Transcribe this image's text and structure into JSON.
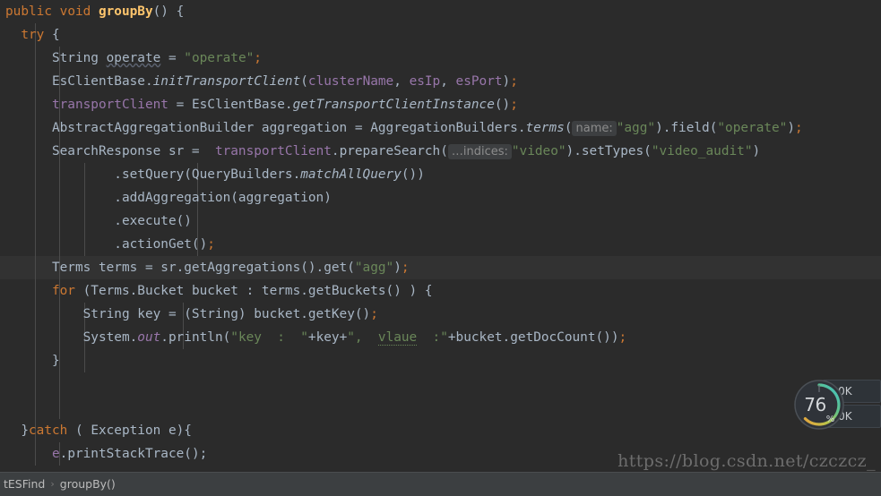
{
  "editor": {
    "lines": [
      {
        "indent_guides": [],
        "tokens": [
          {
            "t": "public",
            "c": "kw"
          },
          {
            "t": " ",
            "c": "plain"
          },
          {
            "t": "void",
            "c": "kw"
          },
          {
            "t": " ",
            "c": "plain"
          },
          {
            "t": "groupBy",
            "c": "fn"
          },
          {
            "t": "() {",
            "c": "punc"
          }
        ]
      },
      {
        "indent_guides": [
          39
        ],
        "tokens": [
          {
            "t": "  ",
            "c": "plain"
          },
          {
            "t": "try",
            "c": "kw"
          },
          {
            "t": " {",
            "c": "punc"
          }
        ]
      },
      {
        "indent_guides": [
          39,
          66
        ],
        "tokens": [
          {
            "t": "      ",
            "c": "plain"
          },
          {
            "t": "String",
            "c": "plain"
          },
          {
            "t": " ",
            "c": "plain"
          },
          {
            "t": "operate",
            "c": "warnvar"
          },
          {
            "t": " = ",
            "c": "punc"
          },
          {
            "t": "\"operate\"",
            "c": "str"
          },
          {
            "t": ";",
            "c": "semi"
          }
        ]
      },
      {
        "indent_guides": [
          39,
          66
        ],
        "tokens": [
          {
            "t": "      ",
            "c": "plain"
          },
          {
            "t": "EsClientBase.",
            "c": "plain"
          },
          {
            "t": "initTransportClient",
            "c": "stat-m"
          },
          {
            "t": "(",
            "c": "punc"
          },
          {
            "t": "clusterName",
            "c": "fld"
          },
          {
            "t": ", ",
            "c": "punc"
          },
          {
            "t": "esIp",
            "c": "fld"
          },
          {
            "t": ", ",
            "c": "punc"
          },
          {
            "t": "esPort",
            "c": "fld"
          },
          {
            "t": ")",
            "c": "punc"
          },
          {
            "t": ";",
            "c": "semi"
          }
        ]
      },
      {
        "indent_guides": [
          39,
          66
        ],
        "tokens": [
          {
            "t": "      ",
            "c": "plain"
          },
          {
            "t": "transportClient",
            "c": "fld"
          },
          {
            "t": " = ",
            "c": "punc"
          },
          {
            "t": "EsClientBase.",
            "c": "plain"
          },
          {
            "t": "getTransportClientInstance",
            "c": "stat-m"
          },
          {
            "t": "()",
            "c": "punc"
          },
          {
            "t": ";",
            "c": "semi"
          }
        ]
      },
      {
        "indent_guides": [
          39,
          66
        ],
        "tokens": [
          {
            "t": "      ",
            "c": "plain"
          },
          {
            "t": "AbstractAggregationBuilder aggregation = AggregationBuilders.",
            "c": "plain"
          },
          {
            "t": "terms",
            "c": "stat-m"
          },
          {
            "t": "(",
            "c": "punc"
          },
          {
            "t": "name:",
            "c": "hint"
          },
          {
            "t": "\"agg\"",
            "c": "str"
          },
          {
            "t": ").field(",
            "c": "punc"
          },
          {
            "t": "\"operate\"",
            "c": "str"
          },
          {
            "t": ")",
            "c": "punc"
          },
          {
            "t": ";",
            "c": "semi"
          }
        ]
      },
      {
        "indent_guides": [
          39,
          66
        ],
        "tokens": [
          {
            "t": "      ",
            "c": "plain"
          },
          {
            "t": "SearchResponse sr =  ",
            "c": "plain"
          },
          {
            "t": "transportClient",
            "c": "fld"
          },
          {
            "t": ".prepareSearch(",
            "c": "punc"
          },
          {
            "t": "…indices:",
            "c": "hint"
          },
          {
            "t": "\"video\"",
            "c": "str"
          },
          {
            "t": ").setTypes(",
            "c": "punc"
          },
          {
            "t": "\"video_audit\"",
            "c": "str"
          },
          {
            "t": ")",
            "c": "punc"
          }
        ]
      },
      {
        "indent_guides": [
          39,
          66,
          94,
          220
        ],
        "tokens": [
          {
            "t": "              .setQuery(QueryBuilders.",
            "c": "plain"
          },
          {
            "t": "matchAllQuery",
            "c": "stat-m"
          },
          {
            "t": "())",
            "c": "punc"
          }
        ]
      },
      {
        "indent_guides": [
          39,
          66,
          94,
          220
        ],
        "tokens": [
          {
            "t": "              .addAggregation(aggregation)",
            "c": "plain"
          }
        ]
      },
      {
        "indent_guides": [
          39,
          66,
          94,
          220
        ],
        "tokens": [
          {
            "t": "              .execute()",
            "c": "plain"
          }
        ]
      },
      {
        "indent_guides": [
          39,
          66,
          94,
          220
        ],
        "tokens": [
          {
            "t": "              .actionGet()",
            "c": "plain"
          },
          {
            "t": ";",
            "c": "semi"
          }
        ]
      },
      {
        "current": true,
        "indent_guides": [
          39,
          66
        ],
        "tokens": [
          {
            "t": "      ",
            "c": "plain"
          },
          {
            "t": "Terms terms = sr.getAggregations().get(",
            "c": "plain"
          },
          {
            "t": "\"agg\"",
            "c": "str"
          },
          {
            "t": ")",
            "c": "punc"
          },
          {
            "t": ";",
            "c": "semi"
          }
        ]
      },
      {
        "indent_guides": [
          39,
          66
        ],
        "tokens": [
          {
            "t": "      ",
            "c": "plain"
          },
          {
            "t": "for",
            "c": "kw"
          },
          {
            "t": " (Terms.Bucket bucket : terms.getBuckets() ) {",
            "c": "plain"
          }
        ]
      },
      {
        "indent_guides": [
          39,
          66,
          94,
          204
        ],
        "tokens": [
          {
            "t": "          String key = (String) bucket.getKey()",
            "c": "plain"
          },
          {
            "t": ";",
            "c": "semi"
          }
        ]
      },
      {
        "indent_guides": [
          39,
          66,
          94,
          204
        ],
        "tokens": [
          {
            "t": "          System.",
            "c": "plain"
          },
          {
            "t": "out",
            "c": "stat-f"
          },
          {
            "t": ".println(",
            "c": "plain"
          },
          {
            "t": "\"key  :  \"",
            "c": "str"
          },
          {
            "t": "+key+",
            "c": "plain"
          },
          {
            "t": "\",  ",
            "c": "str"
          },
          {
            "t": "vlaue",
            "c": "greyvar"
          },
          {
            "t": "  :\"",
            "c": "str"
          },
          {
            "t": "+bucket.getDocCount())",
            "c": "plain"
          },
          {
            "t": ";",
            "c": "semi"
          }
        ]
      },
      {
        "indent_guides": [
          39,
          66,
          94
        ],
        "tokens": [
          {
            "t": "      }",
            "c": "plain"
          }
        ]
      },
      {
        "indent_guides": [
          39,
          66
        ],
        "tokens": [
          {
            "t": "",
            "c": "plain"
          }
        ]
      },
      {
        "indent_guides": [
          39,
          66
        ],
        "tokens": [
          {
            "t": "",
            "c": "plain"
          }
        ]
      },
      {
        "indent_guides": [
          39
        ],
        "tokens": [
          {
            "t": "  }",
            "c": "plain"
          },
          {
            "t": "catch",
            "c": "kw"
          },
          {
            "t": " ( Exception e){",
            "c": "plain"
          }
        ]
      },
      {
        "indent_guides": [
          39,
          66
        ],
        "tokens": [
          {
            "t": "      ",
            "c": "plain"
          },
          {
            "t": "e",
            "c": "fld"
          },
          {
            "t": ".printStackTrace();",
            "c": "plain"
          }
        ]
      }
    ]
  },
  "breadcrumb": {
    "items": [
      "tESFind",
      "groupBy()"
    ],
    "separator": "›"
  },
  "watermark": {
    "text": "https://blog.csdn.net/czczcz_"
  },
  "netmon": {
    "percent": "76",
    "percent_symbol": "%",
    "upload_arrow": "↑",
    "upload_speed": "0K",
    "download_arrow": "↓",
    "download_speed": "0K"
  },
  "colors": {
    "editor_background": "#2b2b2b",
    "current_line": "#323232",
    "breadcrumb_background": "#3c3f41",
    "keyword": "#cc7832",
    "string": "#6a8759",
    "method": "#ffc66d",
    "field": "#9876aa",
    "default_text": "#a9b7c6",
    "hint_chip": "#3d3f41",
    "ring_start": "#3fc1c9",
    "ring_mid": "#a6c34a",
    "ring_end": "#e8a33d"
  }
}
